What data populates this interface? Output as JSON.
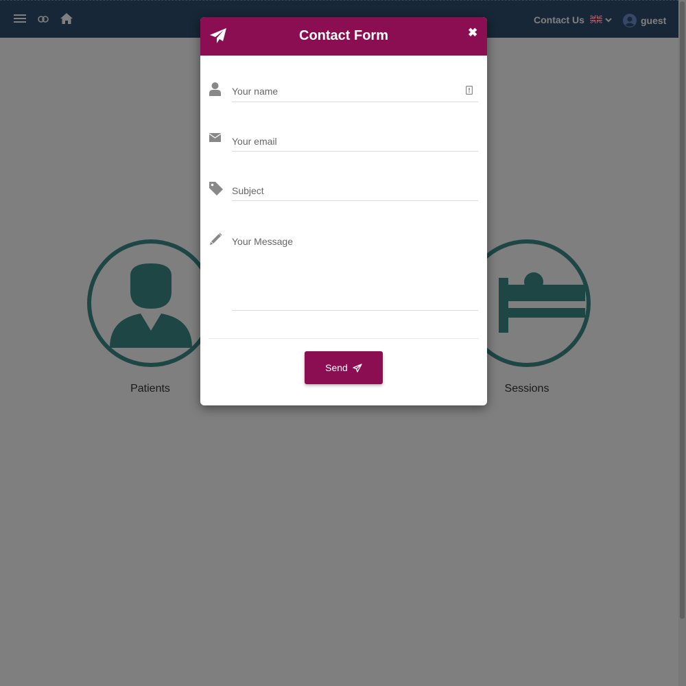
{
  "navbar": {
    "contact_label": "Contact Us",
    "user_label": "guest",
    "icons": [
      "menu-icon",
      "toggle-icon",
      "home-icon",
      "uk-flag-icon",
      "chevron-down-icon",
      "user-avatar-icon"
    ]
  },
  "tiles": [
    {
      "label": "Patients",
      "icon": "doctor-icon"
    },
    {
      "label": "Sessions",
      "icon": "hospital-bed-icon"
    }
  ],
  "modal": {
    "title": "Contact Form",
    "close_symbol": "✖",
    "fields": {
      "name_placeholder": "Your name",
      "email_placeholder": "Your email",
      "subject_placeholder": "Subject",
      "message_placeholder": "Your Message"
    },
    "send_label": "Send"
  },
  "colors": {
    "navbar": "#2f4f6e",
    "accent": "#8b0e52",
    "tile_icon": "#3b8c8a"
  }
}
